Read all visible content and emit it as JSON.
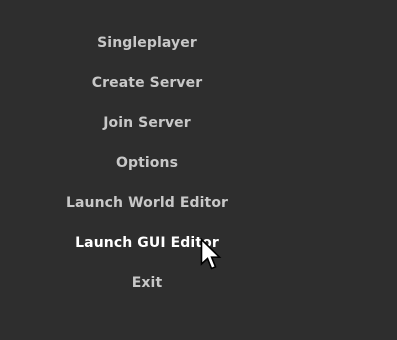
{
  "menu": {
    "items": [
      {
        "id": "singleplayer",
        "label": "Singleplayer",
        "hovered": false
      },
      {
        "id": "create-server",
        "label": "Create Server",
        "hovered": false
      },
      {
        "id": "join-server",
        "label": "Join Server",
        "hovered": false
      },
      {
        "id": "options",
        "label": "Options",
        "hovered": false
      },
      {
        "id": "launch-world-editor",
        "label": "Launch World Editor",
        "hovered": false
      },
      {
        "id": "launch-gui-editor",
        "label": "Launch GUI Editor",
        "hovered": true
      },
      {
        "id": "exit",
        "label": "Exit",
        "hovered": false
      }
    ]
  },
  "colors": {
    "background": "#2e2e2e",
    "item_text": "#c8c8c8",
    "item_text_hover": "#ffffff"
  },
  "cursor": {
    "icon": "mouse-pointer-icon"
  }
}
